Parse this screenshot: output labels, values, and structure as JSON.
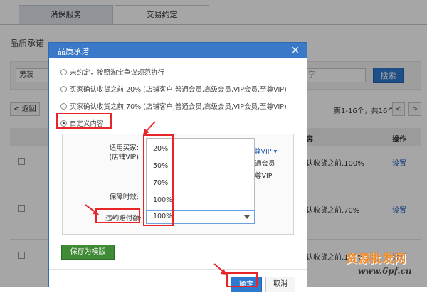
{
  "tabs": [
    {
      "label": "消保服务"
    },
    {
      "label": "交易约定"
    }
  ],
  "section_title": "品质承诺",
  "filter": {
    "select_value": "男装",
    "input_text": "字",
    "search_label": "搜索"
  },
  "pager": {
    "prev_label": "< 返回",
    "info": "第1-16个，共16个",
    "prev_icon": "<",
    "next_icon": ">"
  },
  "table": {
    "col_partial": "容",
    "col_action": "操作",
    "rows": [
      {
        "text": "认收货之前,100%",
        "action": "设置"
      },
      {
        "text": "认收货之前,70%",
        "action": "设置"
      },
      {
        "text": "认收货之前,100%",
        "action": "设置"
      }
    ]
  },
  "dialog": {
    "title": "品质承诺",
    "close_icon": "×",
    "options": [
      {
        "label": "未约定，按照淘宝争议规范执行",
        "checked": false
      },
      {
        "label": "买家确认收货之前,20% (店铺客户,普通会员,高级会员,VIP会员,至尊VIP)",
        "checked": false
      },
      {
        "label": "买家确认收货之前,70% (店铺客户,普通会员,高级会员,VIP会员,至尊VIP)",
        "checked": false
      },
      {
        "label": "自定义内容",
        "checked": true
      }
    ],
    "custom": {
      "buyer_label": "适用买家:",
      "buyer_sub": "(店铺VIP)",
      "vip_link": "尊VIP ▾",
      "side1": "通会员",
      "side2": "尊VIP",
      "guarantee_label": "保障时效:",
      "penalty_label": "违约赔付额:",
      "dropdown_options": [
        "20%",
        "50%",
        "70%",
        "100%"
      ],
      "selected_value": "100%"
    },
    "save_template_label": "保存为模版",
    "ok_label": "确定",
    "cancel_label": "取消"
  },
  "watermark": {
    "line1": "资源批发网",
    "line2": "www.6pf.cn"
  },
  "colors": {
    "accent": "#3a79c7",
    "annotation": "#e8262a",
    "save_green": "#3f8a34"
  }
}
